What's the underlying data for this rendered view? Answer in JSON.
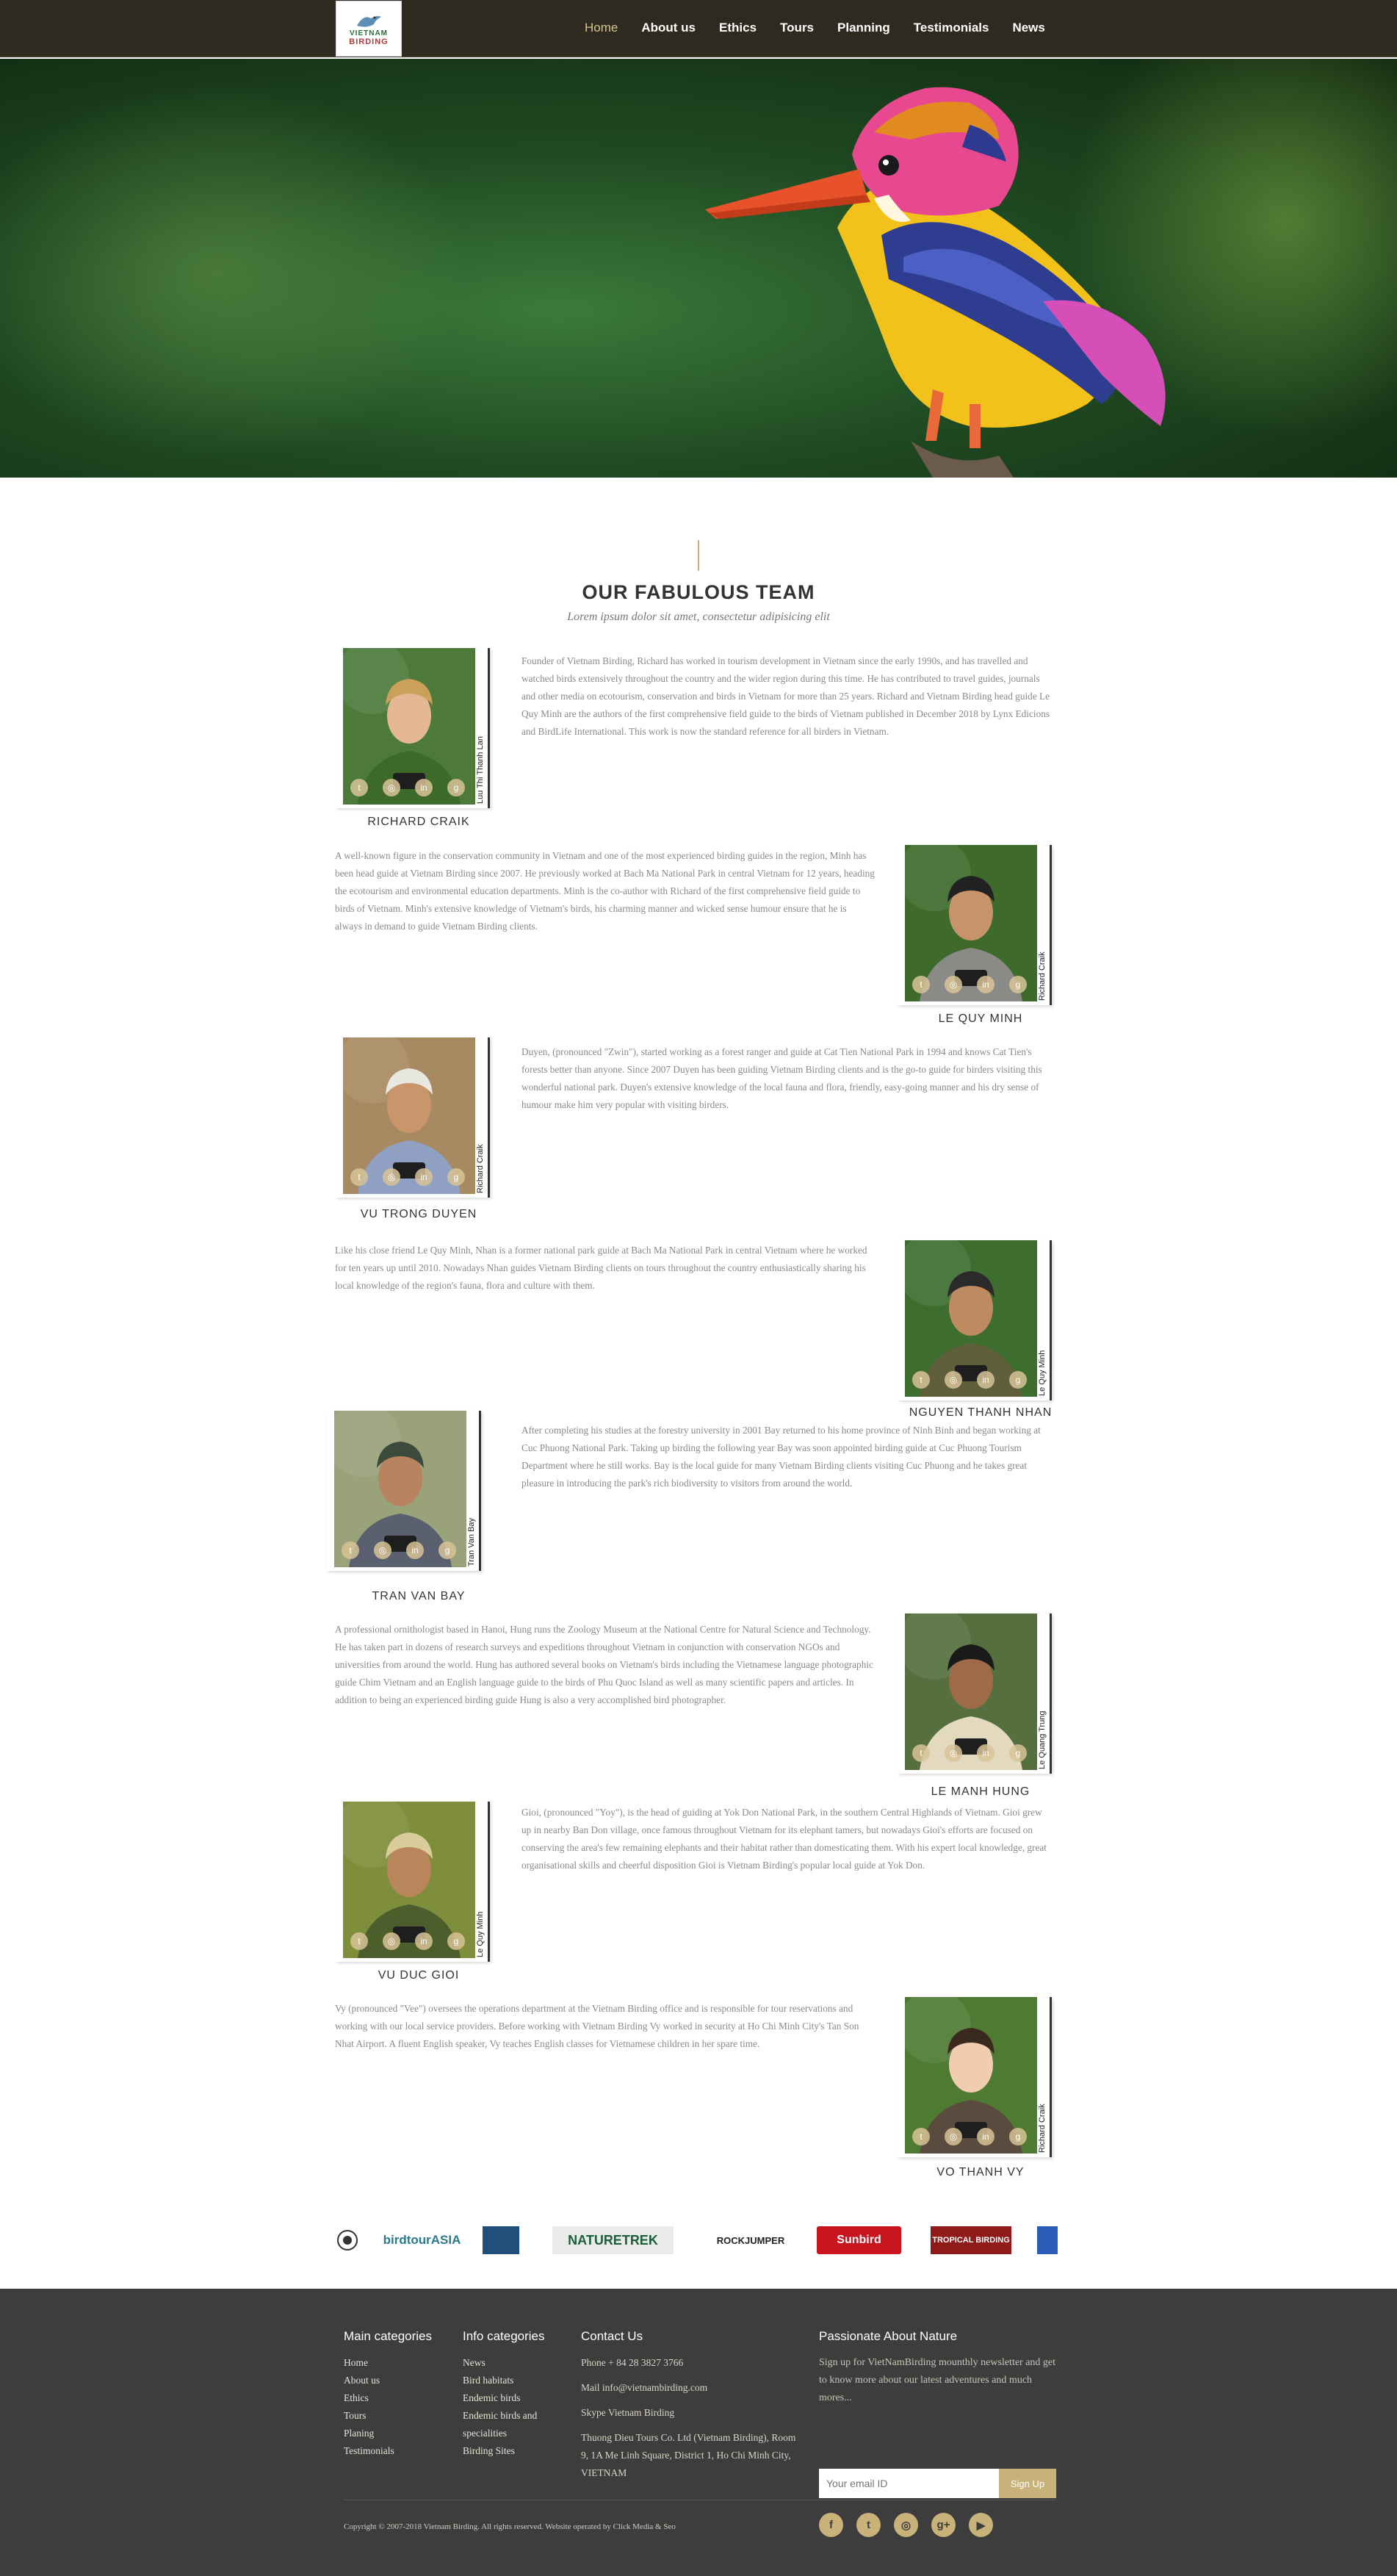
{
  "brand": {
    "logo_line1": "VIETNAM",
    "logo_line2": "BIRDING"
  },
  "nav": {
    "items": [
      "Home",
      "About us",
      "Ethics",
      "Tours",
      "Planning",
      "Testimonials",
      "News"
    ],
    "active": "Home"
  },
  "section": {
    "title": "OUR FABULOUS TEAM",
    "subtitle": "Lorem ipsum dolor sit amet, consectetur adipisicing elit"
  },
  "team": [
    {
      "name": "RICHARD CRAIK",
      "credit": "Luu Thi Thanh Lan",
      "bio": "Founder of Vietnam Birding, Richard has worked in tourism development in Vietnam since the early 1990s, and has travelled and watched birds extensively throughout the country and the wider region during this time. He has contributed to travel guides, journals and other media on ecotourism, conservation and birds in Vietnam for more than 25 years. Richard and Vietnam Birding head guide Le Quy Minh are the authors of the first comprehensive field guide to the birds of Vietnam published in December 2018 by Lynx Edicions and BirdLife International. This work is now the standard reference for all birders in Vietnam."
    },
    {
      "name": "LE QUY MINH",
      "credit": "Richard Craik",
      "bio": "A well-known figure in the conservation community in Vietnam and one of the most experienced birding guides in the region, Minh has been head guide at Vietnam Birding since 2007. He previously worked at Bach Ma National Park in central Vietnam for 12 years, heading the ecotourism and environmental education departments. Minh is the co-author with Richard of the first comprehensive field guide to birds of Vietnam. Minh's extensive knowledge of Vietnam's birds, his charming manner and wicked sense humour ensure that he is always in demand to guide Vietnam Birding clients."
    },
    {
      "name": "VU TRONG DUYEN",
      "credit": "Richard Craik",
      "bio": "Duyen, (pronounced \"Zwin\"), started working as a forest ranger and guide at Cat Tien National Park in 1994 and knows Cat Tien's forests better than anyone. Since 2007 Duyen has been guiding Vietnam Birding clients and is the go-to guide for birders visiting this wonderful national park. Duyen's extensive knowledge of the local fauna and flora, friendly, easy-going manner and his dry sense of humour make him very popular with visiting birders."
    },
    {
      "name": "NGUYEN THANH NHAN",
      "credit": "Le Quy Minh",
      "bio": "Like his close friend Le Quy Minh, Nhan is a former national park guide at Bach Ma National Park in central Vietnam where he worked for ten years up until 2010. Nowadays Nhan guides Vietnam Birding clients on tours throughout the country enthusiastically sharing his local knowledge of the region's fauna, flora and culture with them."
    },
    {
      "name": "TRAN VAN BAY",
      "credit": "Tran Van Bay",
      "bio": "After completing his studies at the forestry university in 2001 Bay returned to his home province of Ninh Binh and began working at Cuc Phuong National Park. Taking up birding the following year Bay was soon appointed birding guide at Cuc Phuong Tourism Department where he still works. Bay is the local guide for many Vietnam Birding clients visiting Cuc Phuong and he takes great pleasure in introducing the park's rich biodiversity to visitors from around the world."
    },
    {
      "name": "LE MANH HUNG",
      "credit": "Le Quang Trung",
      "bio": "A professional ornithologist based in Hanoi, Hung runs the Zoology Museum at the National Centre for Natural Science and Technology. He has taken part in dozens of research surveys and expeditions throughout Vietnam in conjunction with conservation NGOs and universities from around the world. Hung has authored several books on Vietnam's birds including the Vietnamese language photographic guide Chim Vietnam and an English language guide to the birds of Phu Quoc Island as well as many scientific papers and articles. In addition to being an experienced birding guide Hung is also a very accomplished bird photographer."
    },
    {
      "name": "VU DUC GIOI",
      "credit": "Le Quy Minh",
      "bio": "Gioi, (pronounced \"Yoy\"), is the head of guiding at Yok Don National Park, in the southern Central Highlands of Vietnam. Gioi grew up in nearby Ban Don village, once famous throughout Vietnam for its elephant tamers, but nowadays Gioi's efforts are focused on conserving the area's few remaining elephants and their habitat rather than domesticating them. With his expert local knowledge, great organisational skills and cheerful disposition Gioi is Vietnam Birding's popular local guide at Yok Don."
    },
    {
      "name": "VO THANH VY",
      "credit": "Richard Craik",
      "bio": "Vy (pronounced \"Vee\") oversees the operations department at the Vietnam Birding office and is responsible for tour reservations and working with our local service providers. Before working with Vietnam Birding Vy worked in security at Ho Chi Minh City's Tan Son Nhat Airport. A fluent English speaker, Vy teaches English classes for Vietnamese children in her spare time."
    }
  ],
  "partners": [
    "birdtourASIA",
    "NATURETREK",
    "ROCKJUMPER",
    "Sunbird",
    "TROPICAL BIRDING"
  ],
  "footer": {
    "main_categories": {
      "title": "Main categories",
      "items": [
        "Home",
        "About us",
        "Ethics",
        "Tours",
        "Planing",
        "Testimonials"
      ]
    },
    "info_categories": {
      "title": "Info categories",
      "items": [
        "News",
        "Bird habitats",
        "Endemic birds",
        "Endemic birds and",
        "specialities",
        "Birding Sites"
      ]
    },
    "contact": {
      "title": "Contact Us",
      "phone": "Phone + 84 28 3827 3766",
      "mail": "Mail info@vietnambirding.com",
      "skype": "Skype Vietnam Birding",
      "address": "Thuong Dieu Tours Co. Ltd (Vietnam Birding), Room 9, 1A Me Linh Square, District 1, Ho Chi Minh City, VIETNAM"
    },
    "newsletter": {
      "title": "Passionate About Nature",
      "text": "Sign up for VietNamBirding mounthly newsletter and get to know more about our latest adventures and much mores...",
      "placeholder": "Your email ID",
      "button": "Sign Up"
    },
    "copyright": "Copyright © 2007-2018 Vietnam Birding. All rights reserved. Website operated by Click Media & Seo",
    "social_icons": [
      "facebook-icon",
      "twitter-icon",
      "instagram-icon",
      "google-plus-icon",
      "youtube-icon"
    ]
  },
  "colors": {
    "accent": "#c9b27a",
    "topbar": "#2e2a1f",
    "footer": "#3d3d3d"
  }
}
